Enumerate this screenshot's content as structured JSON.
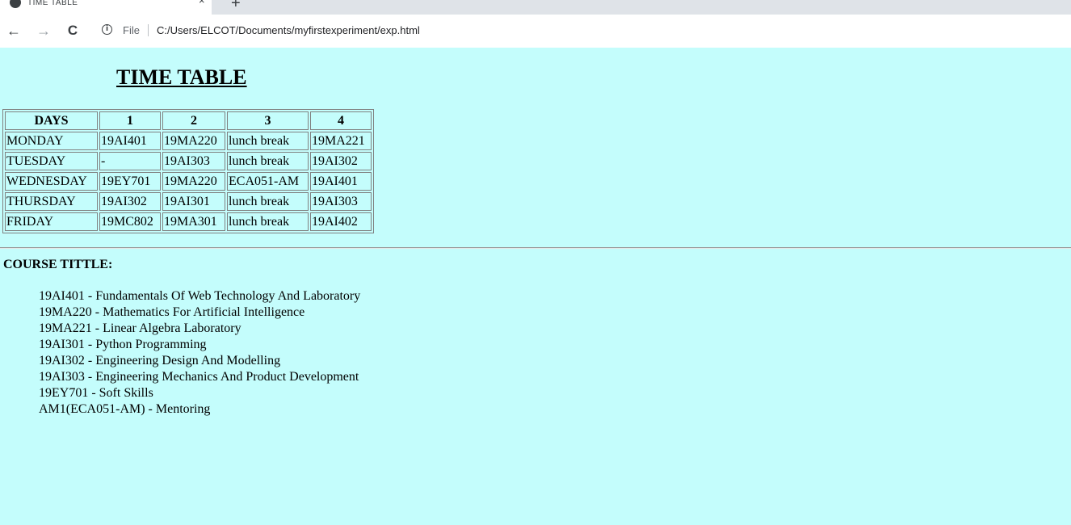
{
  "browser": {
    "tab_title": "TIME TABLE",
    "tab_close": "×",
    "new_tab": "+",
    "back": "←",
    "forward": "→",
    "reload": "C",
    "info": "i",
    "file_label": "File",
    "url": "C:/Users/ELCOT/Documents/myfirstexperiment/exp.html"
  },
  "page": {
    "heading": "TIME TABLE",
    "table": {
      "headers": [
        "DAYS",
        "1",
        "2",
        "3",
        "4"
      ],
      "rows": [
        [
          "MONDAY",
          "19AI401",
          "19MA220",
          "lunch break",
          "19MA221"
        ],
        [
          "TUESDAY",
          "-",
          "19AI303",
          "lunch break",
          "19AI302"
        ],
        [
          "WEDNESDAY",
          "19EY701",
          "19MA220",
          "ECA051-AM",
          "19AI401"
        ],
        [
          "THURSDAY",
          "19AI302",
          "19AI301",
          "lunch break",
          "19AI303"
        ],
        [
          "FRIDAY",
          "19MC802",
          "19MA301",
          "lunch break",
          "19AI402"
        ]
      ]
    },
    "course_heading": "COURSE TITTLE:",
    "courses": [
      "19AI401 - Fundamentals Of Web Technology And Laboratory",
      "19MA220 - Mathematics For Artificial Intelligence",
      "19MA221 - Linear Algebra Laboratory",
      "19AI301 - Python Programming",
      "19AI302 - Engineering Design And Modelling",
      "19AI303 - Engineering Mechanics And Product Development",
      "19EY701 - Soft Skills",
      "AM1(ECA051-AM) - Mentoring"
    ]
  },
  "colors": {
    "page_background": "#c4fdfc",
    "tabstrip": "#dfe3e8",
    "toolbar": "#ffffff"
  }
}
